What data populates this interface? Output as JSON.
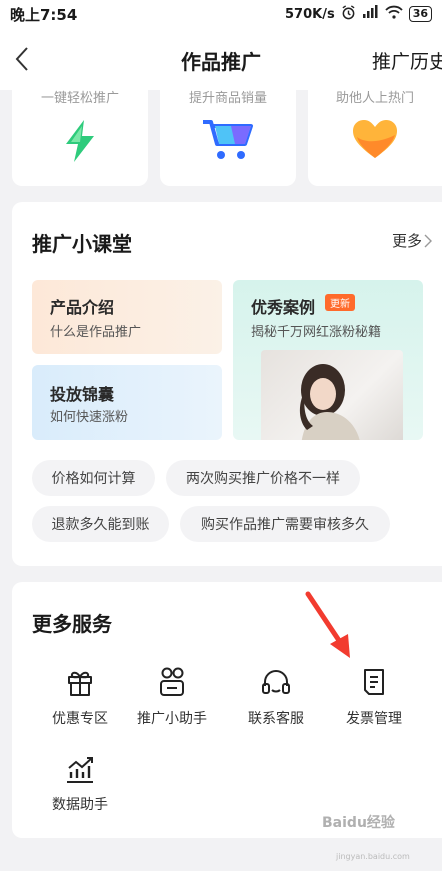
{
  "status_bar": {
    "time": "晚上7:54",
    "speed": "570K/s",
    "battery": "36"
  },
  "nav": {
    "title": "作品推广",
    "history": "推广历史"
  },
  "top_cards": [
    {
      "subtitle": "一键轻松推广",
      "icon": "lightning-icon"
    },
    {
      "subtitle": "提升商品销量",
      "icon": "shopping-cart-icon"
    },
    {
      "subtitle": "助他人上热门",
      "icon": "heart-icon"
    }
  ],
  "course": {
    "title": "推广小课堂",
    "more": "更多",
    "cards": {
      "product": {
        "title": "产品介绍",
        "subtitle": "什么是作品推广"
      },
      "kit": {
        "title": "投放锦囊",
        "subtitle": "如何快速涨粉"
      },
      "case": {
        "title": "优秀案例",
        "badge": "更新",
        "subtitle": "揭秘千万网红涨粉秘籍"
      }
    },
    "chips": [
      "价格如何计算",
      "两次购买推广价格不一样",
      "退款多久能到账",
      "购买作品推广需要审核多久"
    ]
  },
  "services": {
    "title": "更多服务",
    "items": [
      {
        "label": "优惠专区",
        "icon": "gift-box-icon"
      },
      {
        "label": "推广小助手",
        "icon": "assistant-icon"
      },
      {
        "label": "联系客服",
        "icon": "headset-icon"
      },
      {
        "label": "发票管理",
        "icon": "invoice-icon"
      },
      {
        "label": "数据助手",
        "icon": "chart-icon"
      }
    ]
  },
  "watermark": {
    "text": "Baidu经验",
    "url": "jingyan.baidu.com"
  },
  "colors": {
    "accent": "#ff6a2b",
    "arrow": "#f23b2f",
    "background": "#f2f2f4"
  }
}
